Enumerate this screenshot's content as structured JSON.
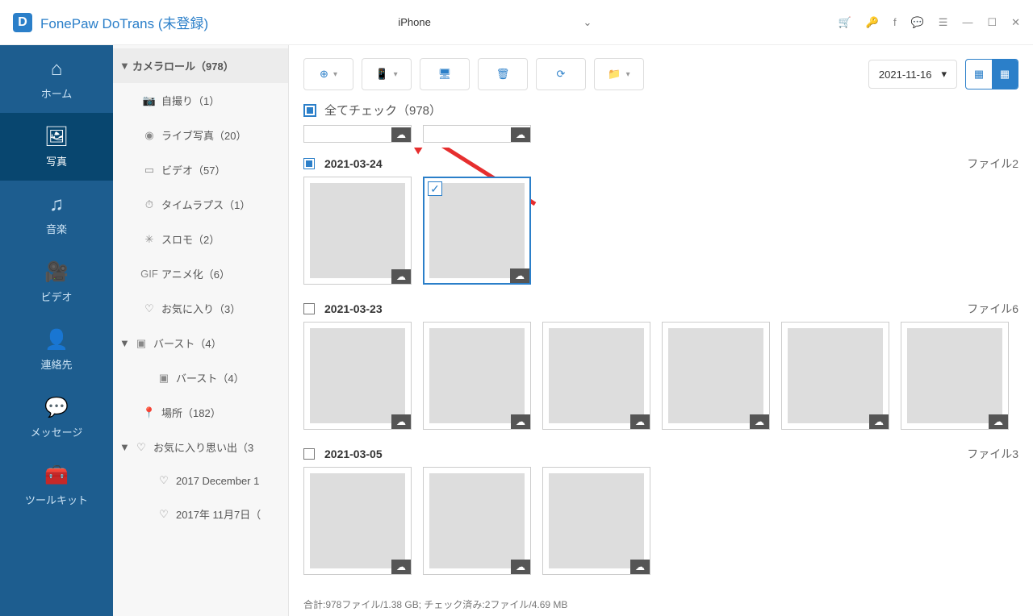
{
  "app": {
    "title": "FonePaw DoTrans (未登録)"
  },
  "device": {
    "name": "iPhone"
  },
  "nav": [
    {
      "key": "home",
      "label": "ホーム"
    },
    {
      "key": "photos",
      "label": "写真"
    },
    {
      "key": "music",
      "label": "音楽"
    },
    {
      "key": "video",
      "label": "ビデオ"
    },
    {
      "key": "contacts",
      "label": "連絡先"
    },
    {
      "key": "messages",
      "label": "メッセージ"
    },
    {
      "key": "toolkit",
      "label": "ツールキット"
    }
  ],
  "tree": {
    "root": "カメラロール（978）",
    "items": [
      {
        "icon": "selfie",
        "label": "自撮り（1）"
      },
      {
        "icon": "live",
        "label": "ライブ写真（20）"
      },
      {
        "icon": "video",
        "label": "ビデオ（57）"
      },
      {
        "icon": "timelapse",
        "label": "タイムラプス（1）"
      },
      {
        "icon": "slomo",
        "label": "スロモ（2）"
      },
      {
        "icon": "gif",
        "label": "アニメ化（6）"
      },
      {
        "icon": "fav",
        "label": "お気に入り（3）"
      }
    ],
    "burst": {
      "label": "バースト（4）",
      "child": "バースト（4）"
    },
    "places": "場所（182）",
    "memories": {
      "label": "お気に入り思い出（3",
      "items": [
        "2017 December 1",
        "2017年 11月7日（"
      ]
    }
  },
  "toolbar": {
    "date": "2021-11-16"
  },
  "checkall": "全てチェック（978）",
  "groups": [
    {
      "date": "2021-03-24",
      "count": "ファイル2",
      "partial": true
    },
    {
      "date": "2021-03-23",
      "count": "ファイル6",
      "partial": false
    },
    {
      "date": "2021-03-05",
      "count": "ファイル3",
      "partial": false
    }
  ],
  "status": "合計:978ファイル/1.38 GB; チェック済み:2ファイル/4.69 MB"
}
